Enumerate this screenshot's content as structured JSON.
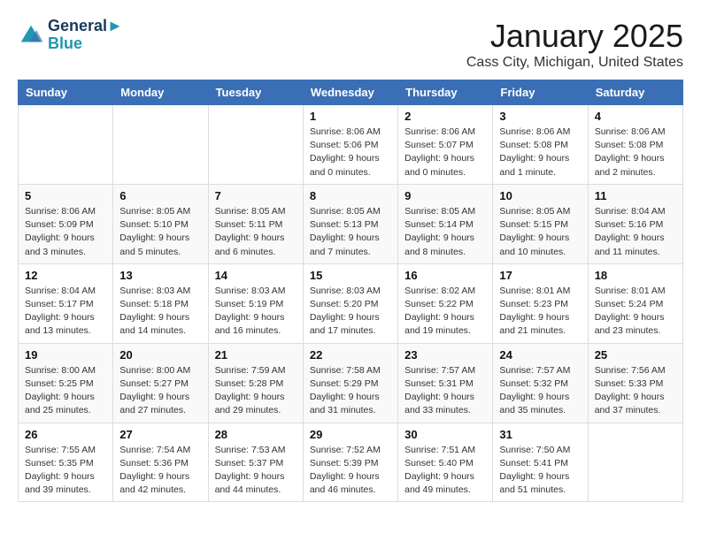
{
  "header": {
    "logo_line1": "General",
    "logo_line2": "Blue",
    "month": "January 2025",
    "location": "Cass City, Michigan, United States"
  },
  "weekdays": [
    "Sunday",
    "Monday",
    "Tuesday",
    "Wednesday",
    "Thursday",
    "Friday",
    "Saturday"
  ],
  "weeks": [
    [
      {
        "day": "",
        "info": ""
      },
      {
        "day": "",
        "info": ""
      },
      {
        "day": "",
        "info": ""
      },
      {
        "day": "1",
        "info": "Sunrise: 8:06 AM\nSunset: 5:06 PM\nDaylight: 9 hours\nand 0 minutes."
      },
      {
        "day": "2",
        "info": "Sunrise: 8:06 AM\nSunset: 5:07 PM\nDaylight: 9 hours\nand 0 minutes."
      },
      {
        "day": "3",
        "info": "Sunrise: 8:06 AM\nSunset: 5:08 PM\nDaylight: 9 hours\nand 1 minute."
      },
      {
        "day": "4",
        "info": "Sunrise: 8:06 AM\nSunset: 5:08 PM\nDaylight: 9 hours\nand 2 minutes."
      }
    ],
    [
      {
        "day": "5",
        "info": "Sunrise: 8:06 AM\nSunset: 5:09 PM\nDaylight: 9 hours\nand 3 minutes."
      },
      {
        "day": "6",
        "info": "Sunrise: 8:05 AM\nSunset: 5:10 PM\nDaylight: 9 hours\nand 5 minutes."
      },
      {
        "day": "7",
        "info": "Sunrise: 8:05 AM\nSunset: 5:11 PM\nDaylight: 9 hours\nand 6 minutes."
      },
      {
        "day": "8",
        "info": "Sunrise: 8:05 AM\nSunset: 5:13 PM\nDaylight: 9 hours\nand 7 minutes."
      },
      {
        "day": "9",
        "info": "Sunrise: 8:05 AM\nSunset: 5:14 PM\nDaylight: 9 hours\nand 8 minutes."
      },
      {
        "day": "10",
        "info": "Sunrise: 8:05 AM\nSunset: 5:15 PM\nDaylight: 9 hours\nand 10 minutes."
      },
      {
        "day": "11",
        "info": "Sunrise: 8:04 AM\nSunset: 5:16 PM\nDaylight: 9 hours\nand 11 minutes."
      }
    ],
    [
      {
        "day": "12",
        "info": "Sunrise: 8:04 AM\nSunset: 5:17 PM\nDaylight: 9 hours\nand 13 minutes."
      },
      {
        "day": "13",
        "info": "Sunrise: 8:03 AM\nSunset: 5:18 PM\nDaylight: 9 hours\nand 14 minutes."
      },
      {
        "day": "14",
        "info": "Sunrise: 8:03 AM\nSunset: 5:19 PM\nDaylight: 9 hours\nand 16 minutes."
      },
      {
        "day": "15",
        "info": "Sunrise: 8:03 AM\nSunset: 5:20 PM\nDaylight: 9 hours\nand 17 minutes."
      },
      {
        "day": "16",
        "info": "Sunrise: 8:02 AM\nSunset: 5:22 PM\nDaylight: 9 hours\nand 19 minutes."
      },
      {
        "day": "17",
        "info": "Sunrise: 8:01 AM\nSunset: 5:23 PM\nDaylight: 9 hours\nand 21 minutes."
      },
      {
        "day": "18",
        "info": "Sunrise: 8:01 AM\nSunset: 5:24 PM\nDaylight: 9 hours\nand 23 minutes."
      }
    ],
    [
      {
        "day": "19",
        "info": "Sunrise: 8:00 AM\nSunset: 5:25 PM\nDaylight: 9 hours\nand 25 minutes."
      },
      {
        "day": "20",
        "info": "Sunrise: 8:00 AM\nSunset: 5:27 PM\nDaylight: 9 hours\nand 27 minutes."
      },
      {
        "day": "21",
        "info": "Sunrise: 7:59 AM\nSunset: 5:28 PM\nDaylight: 9 hours\nand 29 minutes."
      },
      {
        "day": "22",
        "info": "Sunrise: 7:58 AM\nSunset: 5:29 PM\nDaylight: 9 hours\nand 31 minutes."
      },
      {
        "day": "23",
        "info": "Sunrise: 7:57 AM\nSunset: 5:31 PM\nDaylight: 9 hours\nand 33 minutes."
      },
      {
        "day": "24",
        "info": "Sunrise: 7:57 AM\nSunset: 5:32 PM\nDaylight: 9 hours\nand 35 minutes."
      },
      {
        "day": "25",
        "info": "Sunrise: 7:56 AM\nSunset: 5:33 PM\nDaylight: 9 hours\nand 37 minutes."
      }
    ],
    [
      {
        "day": "26",
        "info": "Sunrise: 7:55 AM\nSunset: 5:35 PM\nDaylight: 9 hours\nand 39 minutes."
      },
      {
        "day": "27",
        "info": "Sunrise: 7:54 AM\nSunset: 5:36 PM\nDaylight: 9 hours\nand 42 minutes."
      },
      {
        "day": "28",
        "info": "Sunrise: 7:53 AM\nSunset: 5:37 PM\nDaylight: 9 hours\nand 44 minutes."
      },
      {
        "day": "29",
        "info": "Sunrise: 7:52 AM\nSunset: 5:39 PM\nDaylight: 9 hours\nand 46 minutes."
      },
      {
        "day": "30",
        "info": "Sunrise: 7:51 AM\nSunset: 5:40 PM\nDaylight: 9 hours\nand 49 minutes."
      },
      {
        "day": "31",
        "info": "Sunrise: 7:50 AM\nSunset: 5:41 PM\nDaylight: 9 hours\nand 51 minutes."
      },
      {
        "day": "",
        "info": ""
      }
    ]
  ]
}
